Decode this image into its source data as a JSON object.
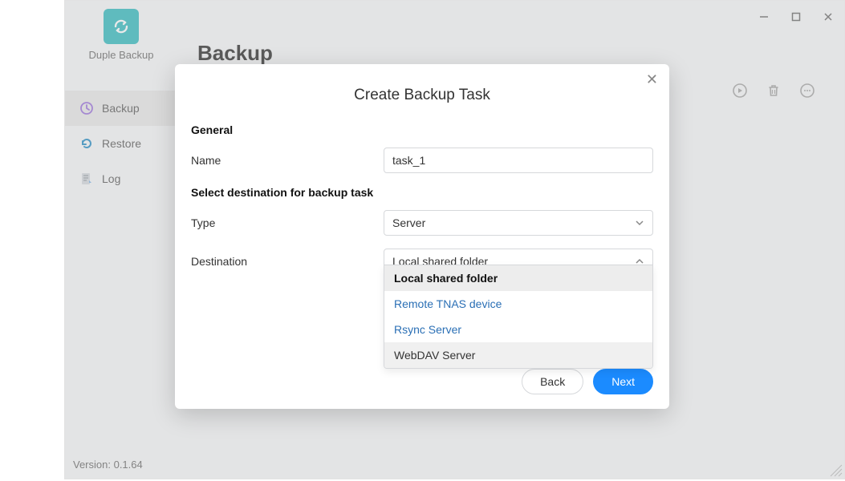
{
  "app": {
    "name": "Duple Backup",
    "version_label": "Version: 0.1.64"
  },
  "sidebar": {
    "items": [
      {
        "label": "Backup",
        "icon": "clock-icon",
        "active": true
      },
      {
        "label": "Restore",
        "icon": "refresh-icon",
        "active": false
      },
      {
        "label": "Log",
        "icon": "log-icon",
        "active": false
      }
    ]
  },
  "page": {
    "title": "Backup"
  },
  "toolbar": {
    "play_label": "Run",
    "delete_label": "Delete",
    "more_label": "More"
  },
  "modal": {
    "title": "Create Backup Task",
    "close_label": "Close",
    "sections": {
      "general_label": "General",
      "destination_section_label": "Select destination for backup task"
    },
    "fields": {
      "name_label": "Name",
      "name_value": "task_1",
      "type_label": "Type",
      "type_value": "Server",
      "destination_label": "Destination",
      "destination_value": "Local shared folder"
    },
    "destination_options": [
      "Local shared folder",
      "Remote TNAS device",
      "Rsync Server",
      "WebDAV Server"
    ],
    "buttons": {
      "back": "Back",
      "next": "Next"
    }
  },
  "window_controls": {
    "minimize": "Minimize",
    "maximize": "Maximize",
    "close": "Close"
  }
}
